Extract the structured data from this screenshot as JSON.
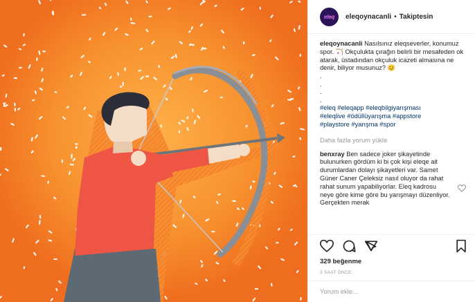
{
  "header": {
    "avatar_text": "eleq",
    "username": "eleqoynacanli",
    "separator": "•",
    "follow_status": "Takiptesin"
  },
  "caption": {
    "username": "eleqoynacanli",
    "text_1": " Nasılsınız eleqseverler, konumuz spor. ",
    "emoji_1": "🏹",
    "text_2": " Okçulukta çırağın belirli bir mesafeden ok atarak, üstadından okçuluk icazeti almasına ne denir, biliyor musunuz? ",
    "emoji_2": "😊",
    "dots": [
      ".",
      ".",
      ".",
      "."
    ],
    "hashtags_line1": "#eleq #eleqapp #eleqbilgiyarışması",
    "hashtags_line2": "#eleqlive #ödüllüyarışma #appstore",
    "hashtags_line3": "#playstore #yarışma #spor"
  },
  "load_more_label": "Daha fazla yorum yükle",
  "comment": {
    "username": "benxray",
    "text": " Ben sadece joker şikayetinde bulunurken gördüm ki bi çok kişi eleqe ait durumlardan dolayı şikayetleri var. Samet Güner Caner Çeleksiz nasıl oluyor da rahat rahat sunum yapabiliyorlar. Eleq kadrosu neye göre kime göre bu yarışmayı düzenliyor. Gerçekten merak"
  },
  "likes": "329 beğenme",
  "timestamp": "3 SAAT ÖNCE",
  "comment_input": {
    "placeholder": "Yorum ekle..."
  },
  "colors": {
    "image_background": "#f07522",
    "image_glow": "#ffb14a",
    "shirt": "#ef5545",
    "pants": "#5d6a74",
    "bow": "#8a8e95",
    "hashtag": "#003569"
  },
  "icons": [
    "heart-icon",
    "comment-icon",
    "share-icon",
    "bookmark-icon",
    "heart-small-icon"
  ]
}
